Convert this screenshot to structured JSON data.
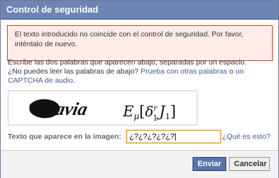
{
  "dialog": {
    "title": "Control de seguridad"
  },
  "error": {
    "message": "El texto introducido no coincide con el control de seguridad. Por favor, inténtalo de nuevo."
  },
  "instructions": {
    "line1": "Escribe las dos palabras que aparecen abajo, separadas por un espacio.",
    "question": "¿No puedes leer las palabras de abajo?",
    "try_other_link": "Prueba con otras palabras",
    "or": "o",
    "audio_link": "un CAPTCHA de audio",
    "period": "."
  },
  "captcha": {
    "word1": "weavia",
    "word2_main": "E",
    "word2_sub": "μ",
    "word2_bracket_left": "[",
    "word2_delta": "δ",
    "word2_sup": "r",
    "word2_sub2": "1",
    "word2_J": "J",
    "word2_sub3": "1",
    "word2_bracket_right": "]"
  },
  "form": {
    "label": "Texto que aparece en la imagen:",
    "value": "¿?¿?¿?¿?¿?|",
    "help_link": "¿Qué es esto?"
  },
  "buttons": {
    "submit": "Enviar",
    "cancel": "Cancelar"
  },
  "colors": {
    "titlebar": "#6d84b4",
    "error_bg": "#ffebe8",
    "error_border": "#dd3c10",
    "link": "#3b5998",
    "primary_button": "#5b74a8"
  }
}
